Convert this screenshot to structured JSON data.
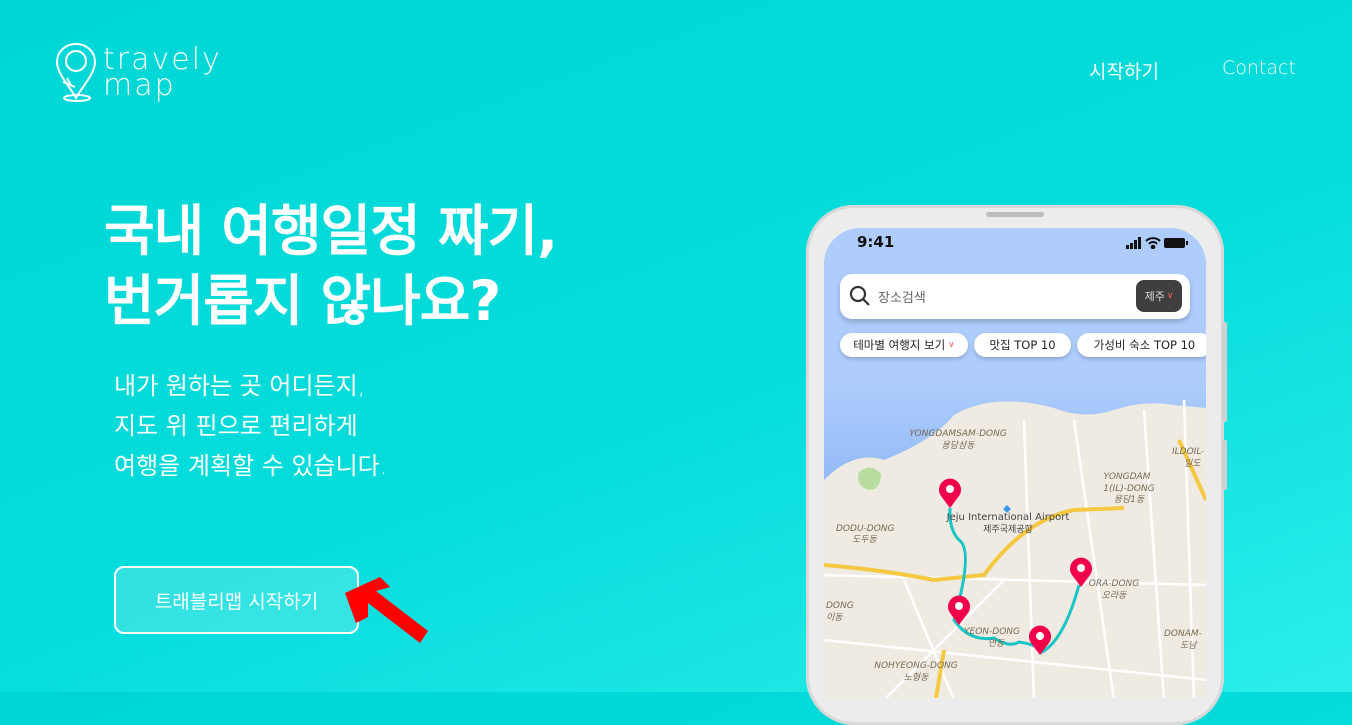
{
  "logo": {
    "line1": "travely",
    "line2": "map"
  },
  "nav": {
    "start": "시작하기",
    "contact": "Contact"
  },
  "hero": {
    "title_line1": "국내 여행일정 짜기,",
    "title_line2": "번거롭지 않나요?",
    "sub_line1": "내가 원하는 곳 어디든지,",
    "sub_line2": "지도 위 핀으로 편리하게",
    "sub_line3": "여행을 계획할 수 있습니다.",
    "cta_label": "트래블리맵 시작하기"
  },
  "phone": {
    "time": "9:41",
    "search_placeholder": "장소검색",
    "region": "제주",
    "chips": [
      "테마별 여행지 보기",
      "맛집 TOP 10",
      "가성비 숙소 TOP 10"
    ],
    "map_labels": {
      "yongdamsam": "YONGDAMSAM-DONG",
      "yongdamsam_ko": "용담삼동",
      "airport": "Jeju International Airport",
      "airport_ko": "제주국제공항",
      "dodu": "DODU-DONG",
      "dodu_ko": "도두동",
      "yongdam1a": "YONGDAM",
      "yongdam1b": "1(IL)-DONG",
      "yongdam1_ko": "용담1동",
      "ildo": "ILDOIL-",
      "ildo_ko": "일도",
      "ora": "ORA-DONG",
      "ora_ko": "오라동",
      "yeon": "YEON-DONG",
      "yeon_ko": "연동",
      "nohyeong": "NOHYEONG-DONG",
      "nohyeong_ko": "노형동",
      "donam": "DONAM-",
      "donam_ko": "도남",
      "idong": "DONG",
      "idong_ko": "이동"
    }
  },
  "colors": {
    "background": "#00d8d8",
    "pin": "#f0004a",
    "route": "#19c4c4",
    "arrow": "#ff0000"
  }
}
